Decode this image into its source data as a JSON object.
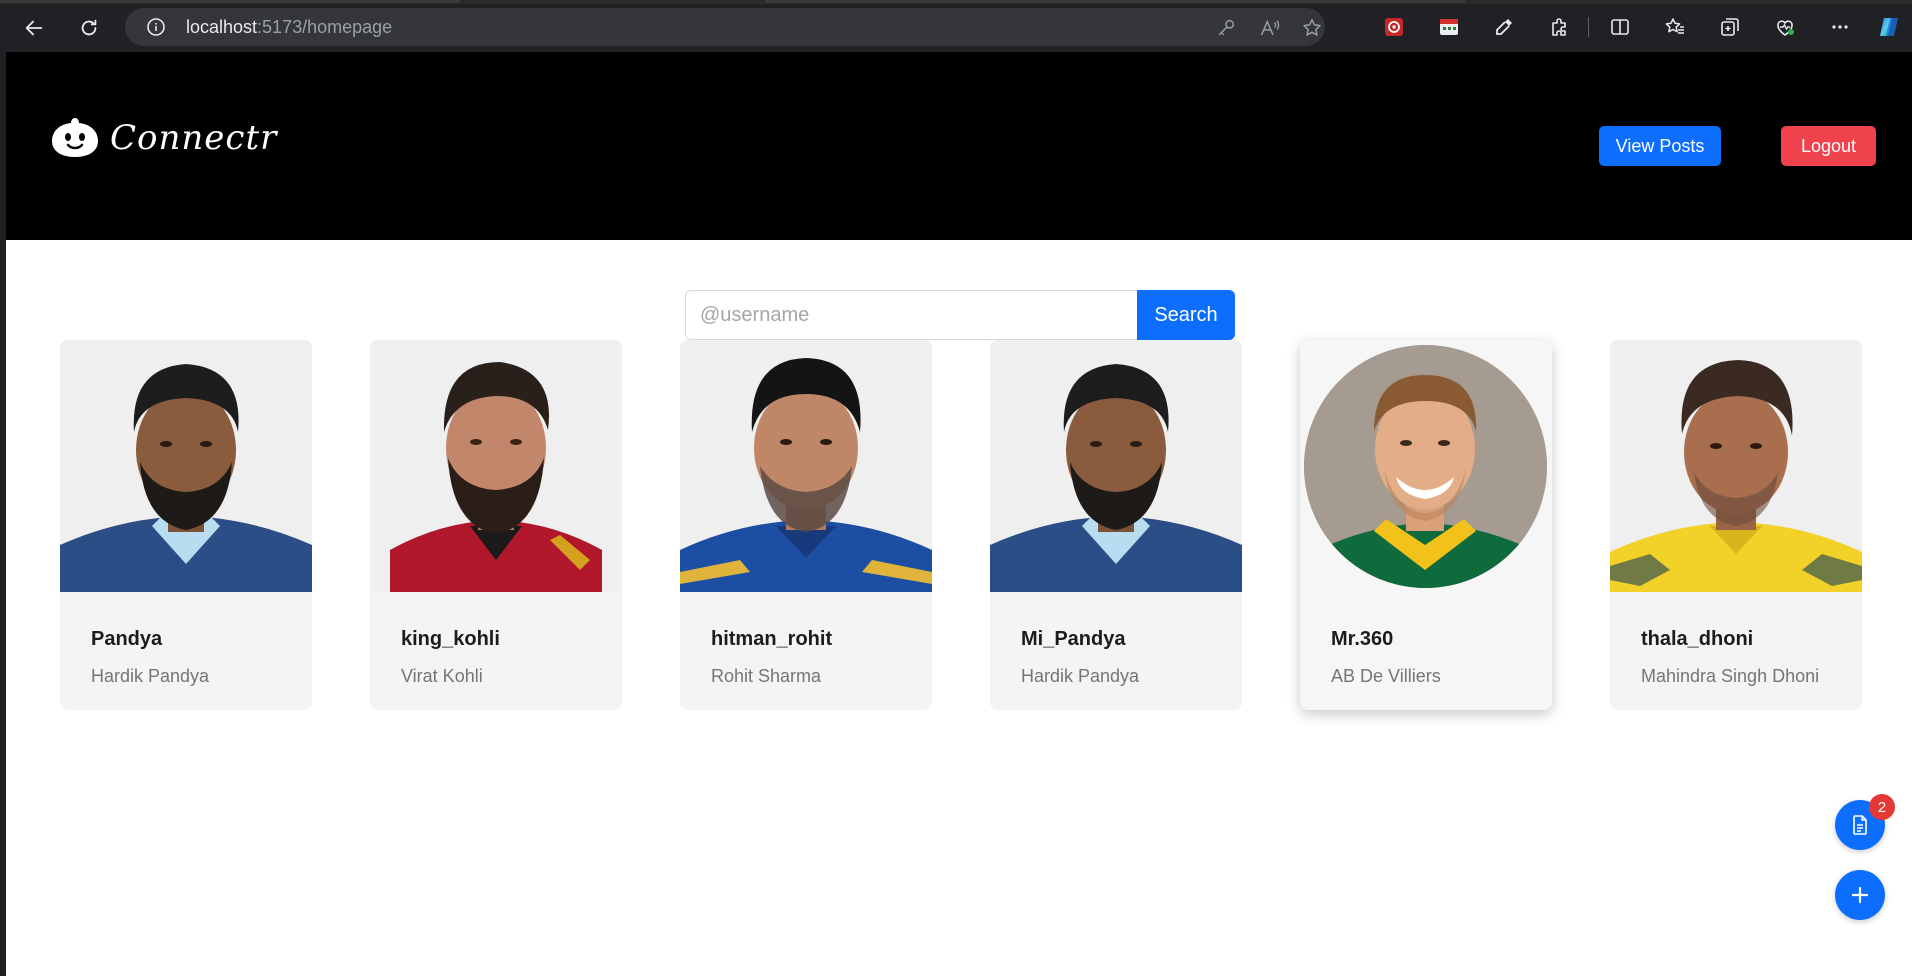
{
  "browser": {
    "url_host": "localhost",
    "url_path": ":5173/homepage"
  },
  "header": {
    "logo_text": "Connectr",
    "view_posts_label": "View Posts",
    "logout_label": "Logout"
  },
  "search": {
    "placeholder": "@username",
    "button_label": "Search"
  },
  "users": [
    {
      "username": "Pandya",
      "name": "Hardik Pandya"
    },
    {
      "username": "king_kohli",
      "name": "Virat Kohli"
    },
    {
      "username": "hitman_rohit",
      "name": "Rohit Sharma"
    },
    {
      "username": "Mi_Pandya",
      "name": "Hardik Pandya"
    },
    {
      "username": "Mr.360",
      "name": "AB De Villiers"
    },
    {
      "username": "thala_dhoni",
      "name": "Mahindra Singh Dhoni"
    }
  ],
  "fab": {
    "posts_badge": "2",
    "posts_icon": "document-icon",
    "add_icon": "plus-icon"
  },
  "colors": {
    "primary": "#0d6efd",
    "danger": "#f0424d",
    "header_bg": "#000000",
    "card_bg": "#f4f4f4",
    "badge": "#e53935"
  }
}
